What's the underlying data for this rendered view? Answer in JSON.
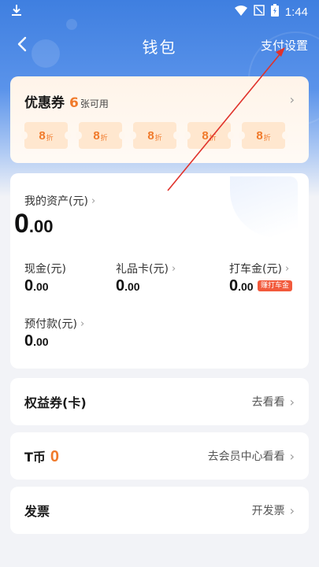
{
  "status_bar": {
    "time": "1:44"
  },
  "header": {
    "title": "钱包",
    "pay_settings": "支付设置"
  },
  "coupons": {
    "title": "优惠券",
    "count": "6",
    "available": "张可用",
    "chips": [
      {
        "value": "8",
        "unit": "折"
      },
      {
        "value": "8",
        "unit": "折"
      },
      {
        "value": "8",
        "unit": "折"
      },
      {
        "value": "8",
        "unit": "折"
      },
      {
        "value": "8",
        "unit": "折"
      }
    ]
  },
  "assets": {
    "total_label": "我的资产(元)",
    "total_int": "0",
    "total_dec": ".00",
    "cash_label": "现金(元)",
    "cash_int": "0",
    "cash_dec": ".00",
    "gift_label": "礼品卡(元)",
    "gift_int": "0",
    "gift_dec": ".00",
    "taxi_label": "打车金(元)",
    "taxi_int": "0",
    "taxi_dec": ".00",
    "taxi_badge": "赚打车金",
    "prepaid_label": "预付款(元)",
    "prepaid_int": "0",
    "prepaid_dec": ".00"
  },
  "rows": {
    "rights_title": "权益券(卡)",
    "rights_action": "去看看",
    "tcoin_title": "T币",
    "tcoin_value": "0",
    "tcoin_action": "去会员中心看看",
    "invoice_title": "发票",
    "invoice_action": "开发票"
  },
  "colors": {
    "accent": "#f07a2b",
    "header_blue": "#3f7fe0",
    "annotation": "#e0322b"
  }
}
